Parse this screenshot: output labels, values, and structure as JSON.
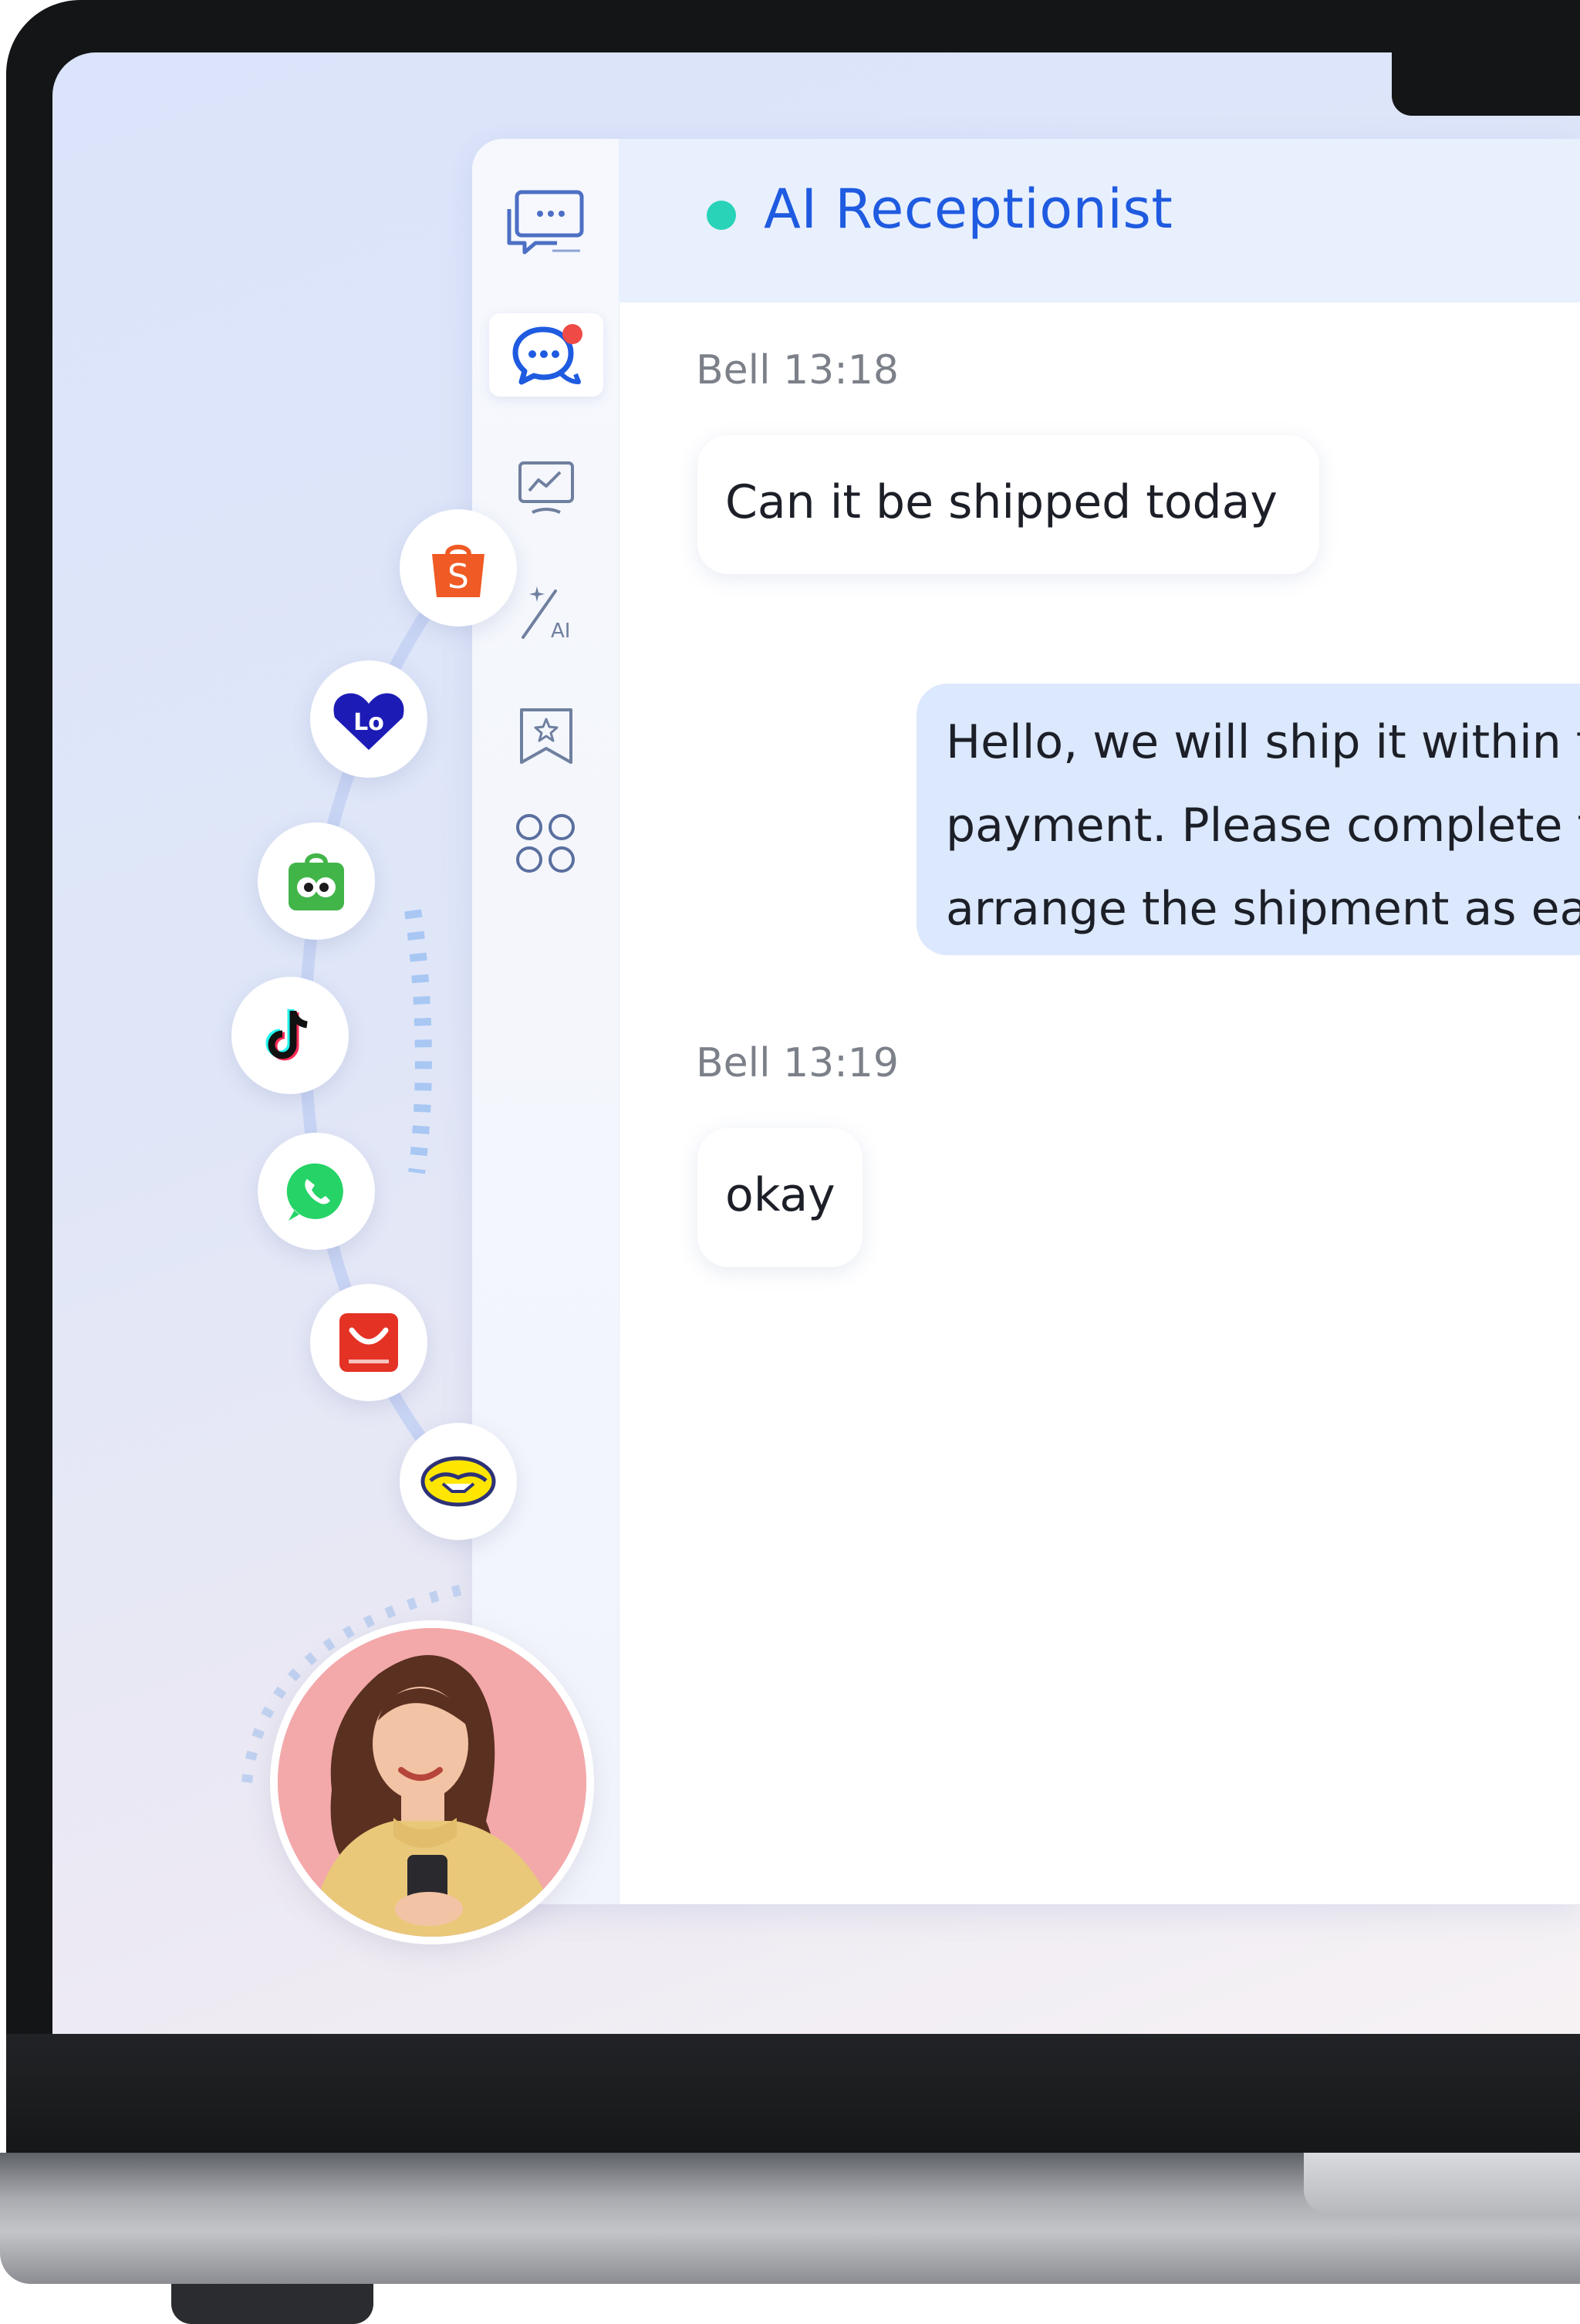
{
  "chat": {
    "title": "AI Receptionist",
    "status": "online",
    "messages": [
      {
        "sender": "Bell",
        "time": "13:18",
        "text": "Can it be shipped today",
        "direction": "incoming"
      },
      {
        "direction": "outgoing",
        "lines": [
          "Hello, we will ship it within t",
          "payment. Please complete t",
          "arrange the shipment as ea"
        ]
      },
      {
        "sender": "Bell",
        "time": "13:19",
        "text": "okay",
        "direction": "incoming"
      }
    ]
  },
  "meta_labels": [
    "Bell 13:18",
    "Bell 13:19"
  ],
  "sidebar": {
    "items": [
      {
        "icon": "chat-screen-icon"
      },
      {
        "icon": "messages-icon",
        "active": true,
        "badge": "red-dot"
      },
      {
        "icon": "analytics-icon"
      },
      {
        "icon": "ai-magic-icon",
        "label": "AI"
      },
      {
        "icon": "bookmark-star-icon"
      },
      {
        "icon": "apps-grid-icon"
      }
    ]
  },
  "platforms": {
    "items": [
      {
        "name": "shopee",
        "glyph": "S",
        "color": "#f05a24"
      },
      {
        "name": "lazada",
        "glyph": "Lo",
        "color": "#1d1bb6"
      },
      {
        "name": "tokopedia",
        "color": "#42b549"
      },
      {
        "name": "tiktok",
        "color": "#111111"
      },
      {
        "name": "whatsapp",
        "color": "#25d366"
      },
      {
        "name": "aliexpress",
        "color": "#e43225"
      },
      {
        "name": "mercado-libre",
        "color": "#ffe600"
      }
    ]
  },
  "colors": {
    "accent": "#1f5be0",
    "status_online": "#28d3b8",
    "bubble_out": "#dbe8fd",
    "header_bg": "#e8f0fd"
  }
}
